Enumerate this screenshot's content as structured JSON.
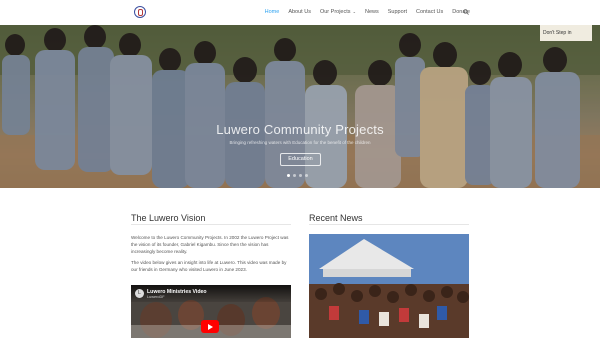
{
  "header": {
    "logo_icon": "seal-logo-icon",
    "nav": [
      {
        "label": "Home",
        "active": true
      },
      {
        "label": "About Us",
        "active": false
      },
      {
        "label": "Our Projects",
        "active": false,
        "dropdown": true
      },
      {
        "label": "News",
        "active": false
      },
      {
        "label": "Support",
        "active": false
      },
      {
        "label": "Contact Us",
        "active": false
      },
      {
        "label": "Donate",
        "active": false
      }
    ],
    "search_icon": "search-icon",
    "accent": "#2ea3f2"
  },
  "hero": {
    "sign_text": "Don't Step in",
    "title": "Luwero Community Projects",
    "subtitle": "Bringing refreshing waters with Education for the benefit of the children",
    "button_label": "Education",
    "slides": 4,
    "current_slide": 1
  },
  "vision": {
    "title": "The Luwero Vision",
    "paragraphs": [
      "Welcome to the Luwero Community Projects. In 2002 the Luwero Project was the vision of its founder, Gabriel Kigambu. Since then the vision has increasingly become reality.",
      "The video below gives an insight into life at Luwero. This video was made by our friends in Germany who visited Luwero in June 2023."
    ],
    "video": {
      "avatar_letter": "L",
      "title": "Luwero Ministries Video",
      "channel": "LuweroDF",
      "play_icon": "youtube-play-icon"
    }
  },
  "news": {
    "title": "Recent News"
  }
}
